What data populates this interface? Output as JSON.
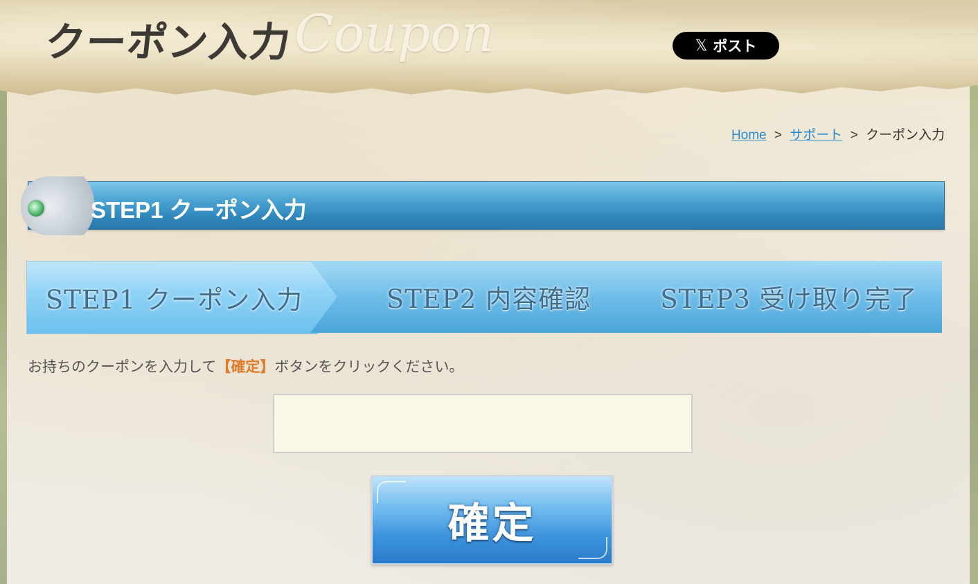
{
  "header": {
    "title": "クーポン入力",
    "subtitle": "Coupon",
    "post_button_label": "ポスト",
    "post_button_icon": "𝕏"
  },
  "breadcrumb": {
    "home": "Home",
    "sep1": ">",
    "support": "サポート",
    "sep2": ">",
    "current": "クーポン入力"
  },
  "section": {
    "title": "STEP1 クーポン入力"
  },
  "steps": [
    {
      "label": "STEP1 クーポン入力",
      "active": true
    },
    {
      "label": "STEP2 内容確認",
      "active": false
    },
    {
      "label": "STEP3 受け取り完了",
      "active": false
    }
  ],
  "instruction": {
    "before": "お持ちのクーポンを入力して",
    "emphasis": "【確定】",
    "after": "ボタンをクリックください。"
  },
  "coupon_input": {
    "value": "",
    "placeholder": ""
  },
  "confirm_button": {
    "label": "確定"
  },
  "colors": {
    "accent_blue": "#4aa3d2",
    "emphasis_orange": "#e07a2a",
    "link_blue": "#2a8ad0",
    "input_bg": "#fbf7e6"
  }
}
